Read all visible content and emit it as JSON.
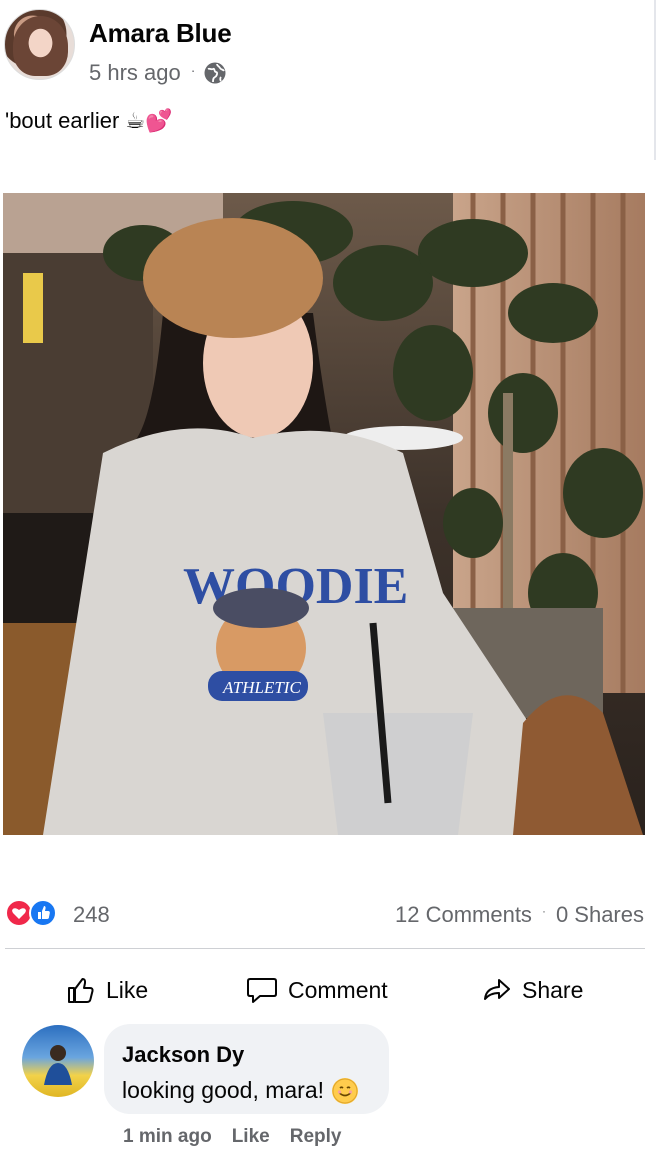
{
  "post": {
    "author": "Amara Blue",
    "time": "5 hrs ago",
    "separator": "·",
    "privacy_icon": "globe-icon",
    "caption": "'bout earlier",
    "caption_emoji": "☕💕"
  },
  "photo": {
    "sweatshirt_text": "WOODIE",
    "patch_text": "ATHLETIC"
  },
  "reactions": {
    "icons": [
      "love-icon",
      "like-icon"
    ],
    "count": "248",
    "comments": "12 Comments",
    "separator": "·",
    "shares": "0 Shares"
  },
  "actions": {
    "like": "Like",
    "comment": "Comment",
    "share": "Share"
  },
  "comment": {
    "name": "Jackson Dy",
    "text": "looking good, mara!",
    "emoji": "smiling-face-icon",
    "time": "1 min ago",
    "like": "Like",
    "reply": "Reply"
  },
  "colors": {
    "text_primary": "#050505",
    "text_secondary": "#65676b",
    "like_blue": "#1877f2",
    "love_red": "#f0284a",
    "bubble_bg": "#f0f2f5"
  }
}
